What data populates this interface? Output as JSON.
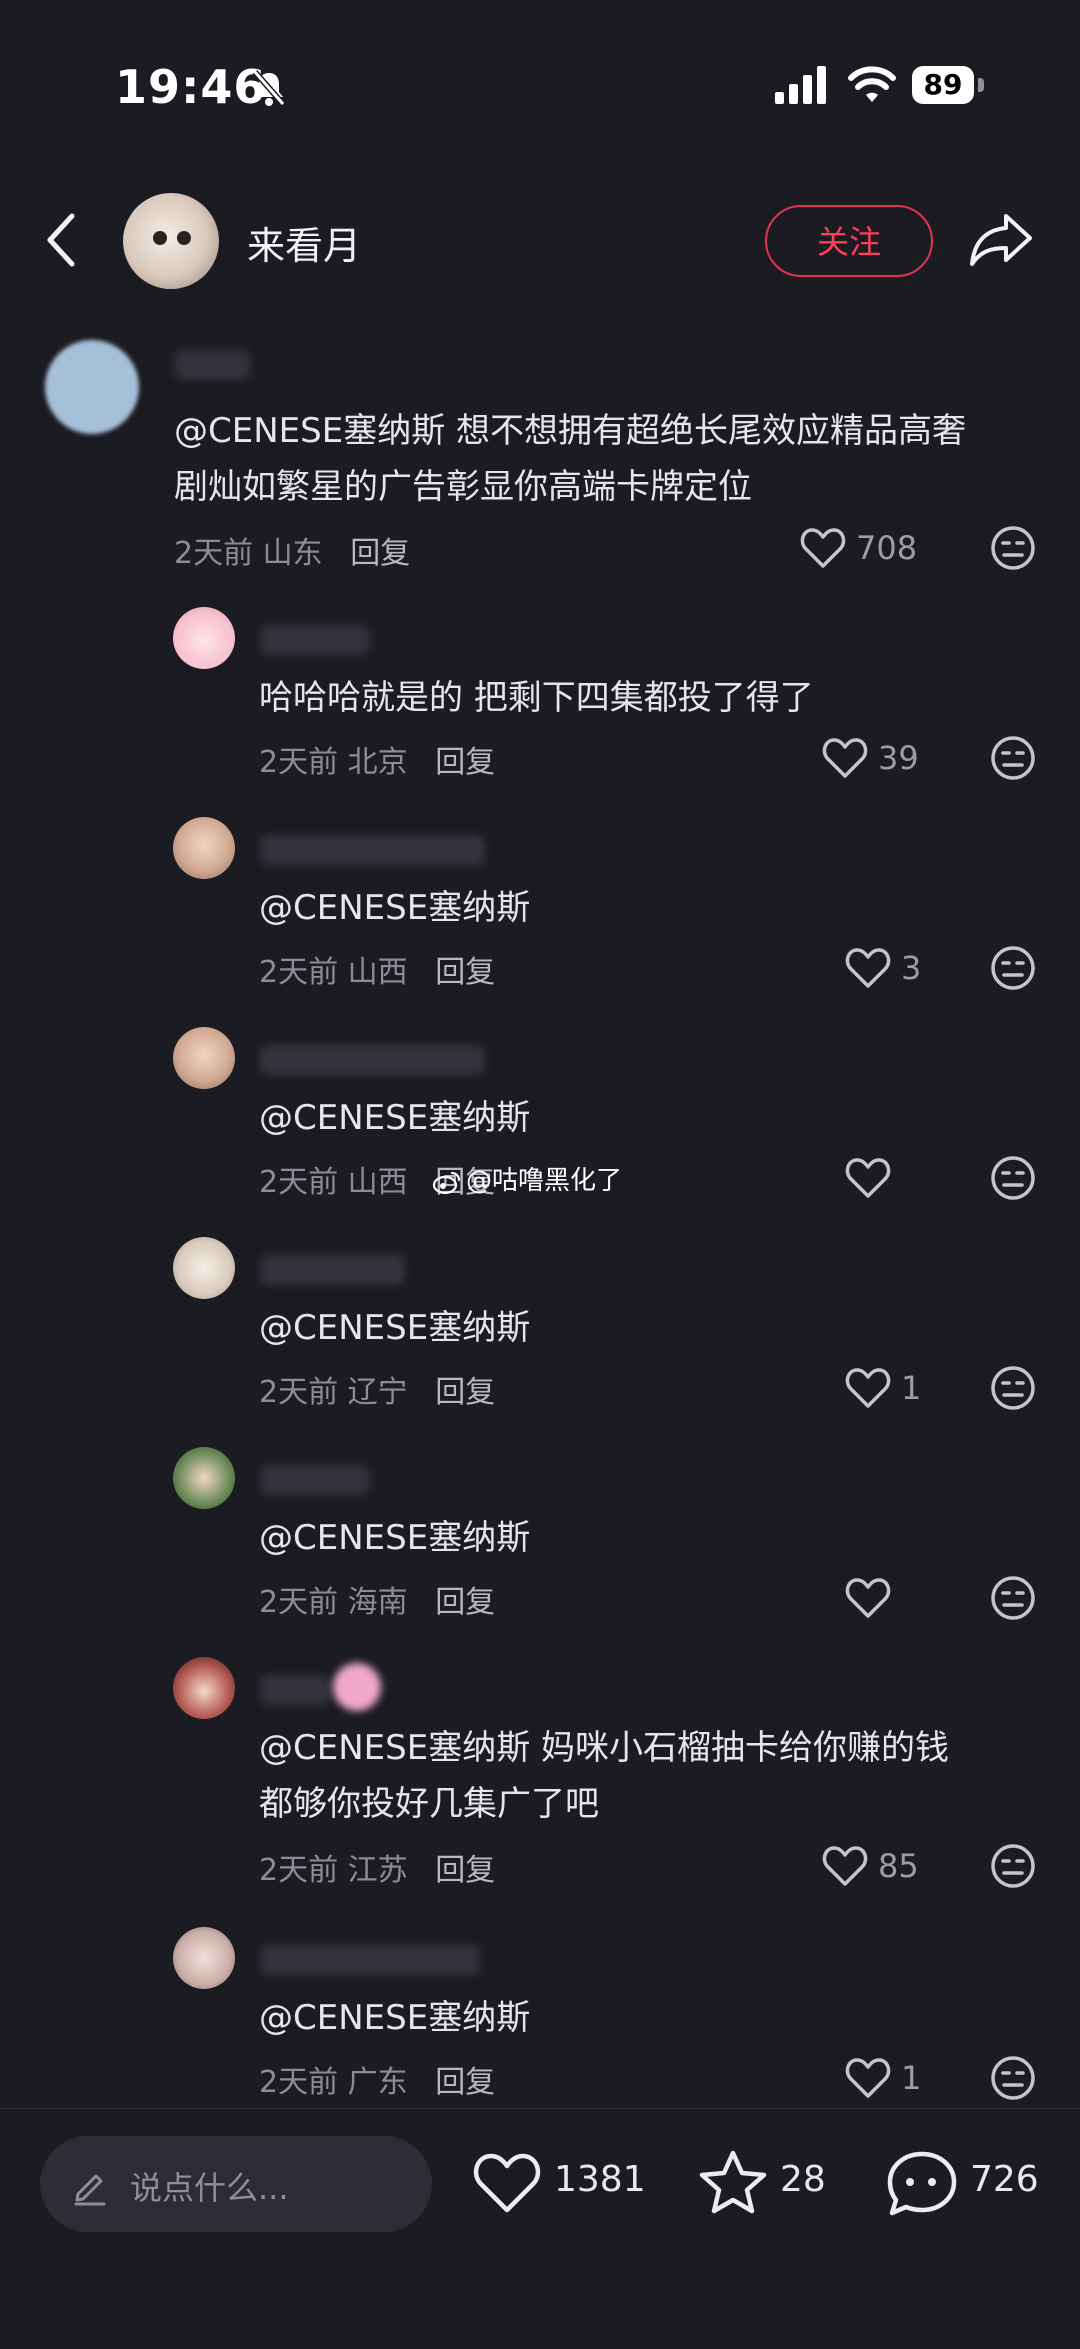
{
  "status_bar": {
    "time": "19:46",
    "battery": "89"
  },
  "header": {
    "username": "来看月",
    "follow_label": "关注"
  },
  "comments": [
    {
      "text": "@CENESE塞纳斯 想不想拥有超绝长尾效应精品高奢剧灿如繁星的广告彰显你高端卡牌定位",
      "lines": [
        "@CENESE塞纳斯 想不想拥有超绝长尾效应精品高奢",
        "剧灿如繁星的广告彰显你高端卡牌定位"
      ],
      "time": "2天前",
      "location": "山东",
      "reply": "回复",
      "likes": "708"
    },
    {
      "text": "哈哈哈就是的 把剩下四集都投了得了",
      "time": "2天前",
      "location": "北京",
      "reply": "回复",
      "likes": "39"
    },
    {
      "text": "@CENESE塞纳斯",
      "time": "2天前",
      "location": "山西",
      "reply": "回复",
      "likes": "3"
    },
    {
      "text": "@CENESE塞纳斯",
      "time": "2天前",
      "location": "山西",
      "reply": "回复",
      "likes": ""
    },
    {
      "text": "@CENESE塞纳斯",
      "time": "2天前",
      "location": "辽宁",
      "reply": "回复",
      "likes": "1"
    },
    {
      "text": "@CENESE塞纳斯",
      "time": "2天前",
      "location": "海南",
      "reply": "回复",
      "likes": ""
    },
    {
      "text": "@CENESE塞纳斯 妈咪小石榴抽卡给你赚的钱都够你投好几集广了吧",
      "lines": [
        "@CENESE塞纳斯  妈咪小石榴抽卡给你赚的钱",
        "都够你投好几集广了吧"
      ],
      "time": "2天前",
      "location": "江苏",
      "reply": "回复",
      "likes": "85"
    },
    {
      "text": "@CENESE塞纳斯",
      "time": "2天前",
      "location": "广东",
      "reply": "回复",
      "likes": "1"
    }
  ],
  "watermark": "@咕噜黑化了",
  "bottom_bar": {
    "input_placeholder": "说点什么...",
    "likes": "1381",
    "favorites": "28",
    "comments": "726"
  }
}
